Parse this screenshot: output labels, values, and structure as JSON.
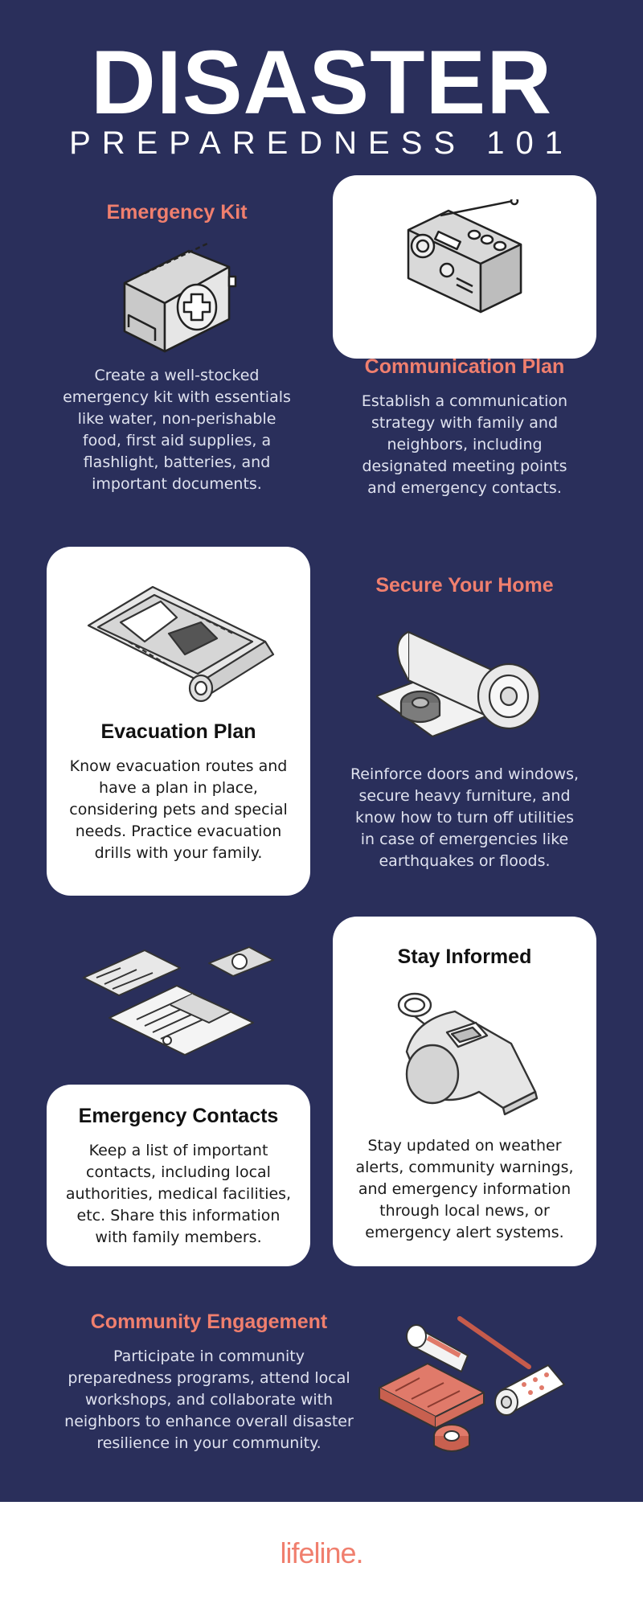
{
  "header": {
    "title": "DISASTER",
    "subtitle": "PREPAREDNESS 101"
  },
  "sections": {
    "emergency_kit": {
      "title": "Emergency Kit",
      "body": "Create a well-stocked emergency kit with essentials like water, non-perishable food, first aid supplies, a flashlight, batteries, and important documents.",
      "icon": "first-aid-kit-icon"
    },
    "communication_plan": {
      "title": "Communication Plan",
      "body": "Establish a communication strategy with family and neighbors, including designated meeting points and emergency contacts.",
      "icon": "radio-icon"
    },
    "evacuation_plan": {
      "title": "Evacuation Plan",
      "body": "Know evacuation routes and have a plan in place, considering pets and special needs. Practice evacuation drills with your family.",
      "icon": "map-icon"
    },
    "secure_home": {
      "title": "Secure Your Home",
      "body": "Reinforce doors and windows, secure heavy furniture, and know how to turn off utilities in case of emergencies like earthquakes or floods.",
      "icon": "plastic-sheet-roll-icon"
    },
    "emergency_contacts": {
      "title": "Emergency Contacts",
      "body": "Keep a list of important contacts, including local authorities, medical facilities, etc. Share this information with family members.",
      "icon": "documents-icon"
    },
    "stay_informed": {
      "title": "Stay Informed",
      "body": "Stay updated on weather alerts, community warnings, and emergency information through local news, or emergency alert systems.",
      "icon": "whistle-icon"
    },
    "community_engagement": {
      "title": "Community Engagement",
      "body": "Participate in community preparedness programs, attend local workshops, and collaborate with neighbors to enhance overall disaster resilience in your community.",
      "icon": "supplies-icon"
    }
  },
  "footer": {
    "logo": "lifeline."
  },
  "colors": {
    "background": "#2a2f5b",
    "accent": "#f07f6e",
    "card": "#ffffff"
  }
}
